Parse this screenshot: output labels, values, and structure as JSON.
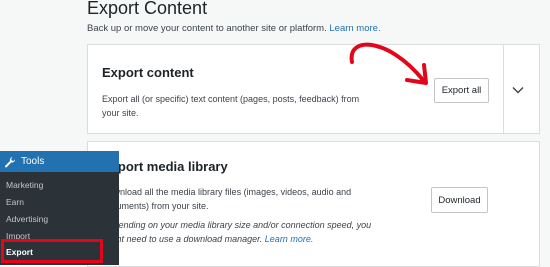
{
  "header": {
    "title": "Export Content",
    "description": "Back up or move your content to another site or platform.",
    "learn_more": "Learn more."
  },
  "export_card": {
    "title": "Export content",
    "text": "Export all (or specific) text content (pages, posts, feedback) from your site.",
    "button": "Export all"
  },
  "media_card": {
    "title": "Export media library",
    "text": "Download all the media library files (images, videos, audio and documents) from your site.",
    "note": "Depending on your media library size and/or connection speed, you might need to use a download manager.",
    "learn_more": "Learn more.",
    "button": "Download"
  },
  "sidebar": {
    "title": "Tools",
    "items": [
      {
        "label": "Marketing"
      },
      {
        "label": "Earn"
      },
      {
        "label": "Advertising"
      },
      {
        "label": "Import"
      }
    ],
    "current": "Export"
  },
  "colors": {
    "annotation": "#e3061b",
    "accent": "#2271b1",
    "sidebar_bg": "#2c3338"
  },
  "icons": {
    "chevron": "chevron-down-icon",
    "tools": "wrench-icon"
  }
}
